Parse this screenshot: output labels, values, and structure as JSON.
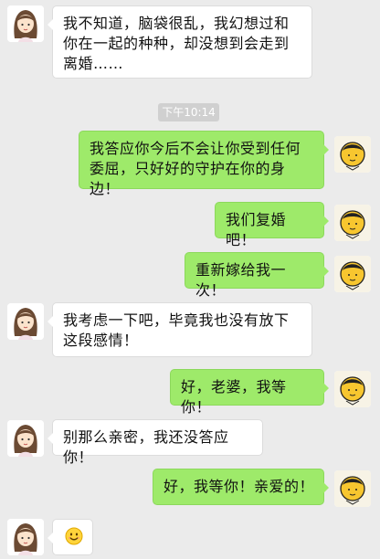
{
  "conversation": {
    "messages": [
      {
        "sender": "她",
        "text": "我不知道，脑袋很乱，我幻想过和你在一起的种种，却没想到会走到离婚……"
      },
      {
        "sender": "我",
        "text": "我答应你今后不会让你受到任何委屈，只好好的守护在你的身边！"
      },
      {
        "sender": "我",
        "text": "我们复婚吧！"
      },
      {
        "sender": "我",
        "text": "重新嫁给我一次！"
      },
      {
        "sender": "她",
        "text": "我考虑一下吧，毕竟我也没有放下这段感情！"
      },
      {
        "sender": "我",
        "text": "好，老婆，我等你！"
      },
      {
        "sender": "她",
        "text": "别那么亲密，我还没答应你！"
      },
      {
        "sender": "我",
        "text": "好，我等你！亲爱的！"
      },
      {
        "sender": "她",
        "emoji": "smile-emoji"
      }
    ],
    "timestamp": "下午10:14"
  },
  "colors": {
    "background": "#ebebeb",
    "outgoing_bubble": "#9eea6a",
    "incoming_bubble": "#ffffff",
    "timestamp_bg": "#d0d0d0"
  },
  "icons": {
    "her_avatar": "girl-avatar-icon",
    "my_avatar": "boy-avatar-icon",
    "last_message": "smile-emoji-icon"
  }
}
